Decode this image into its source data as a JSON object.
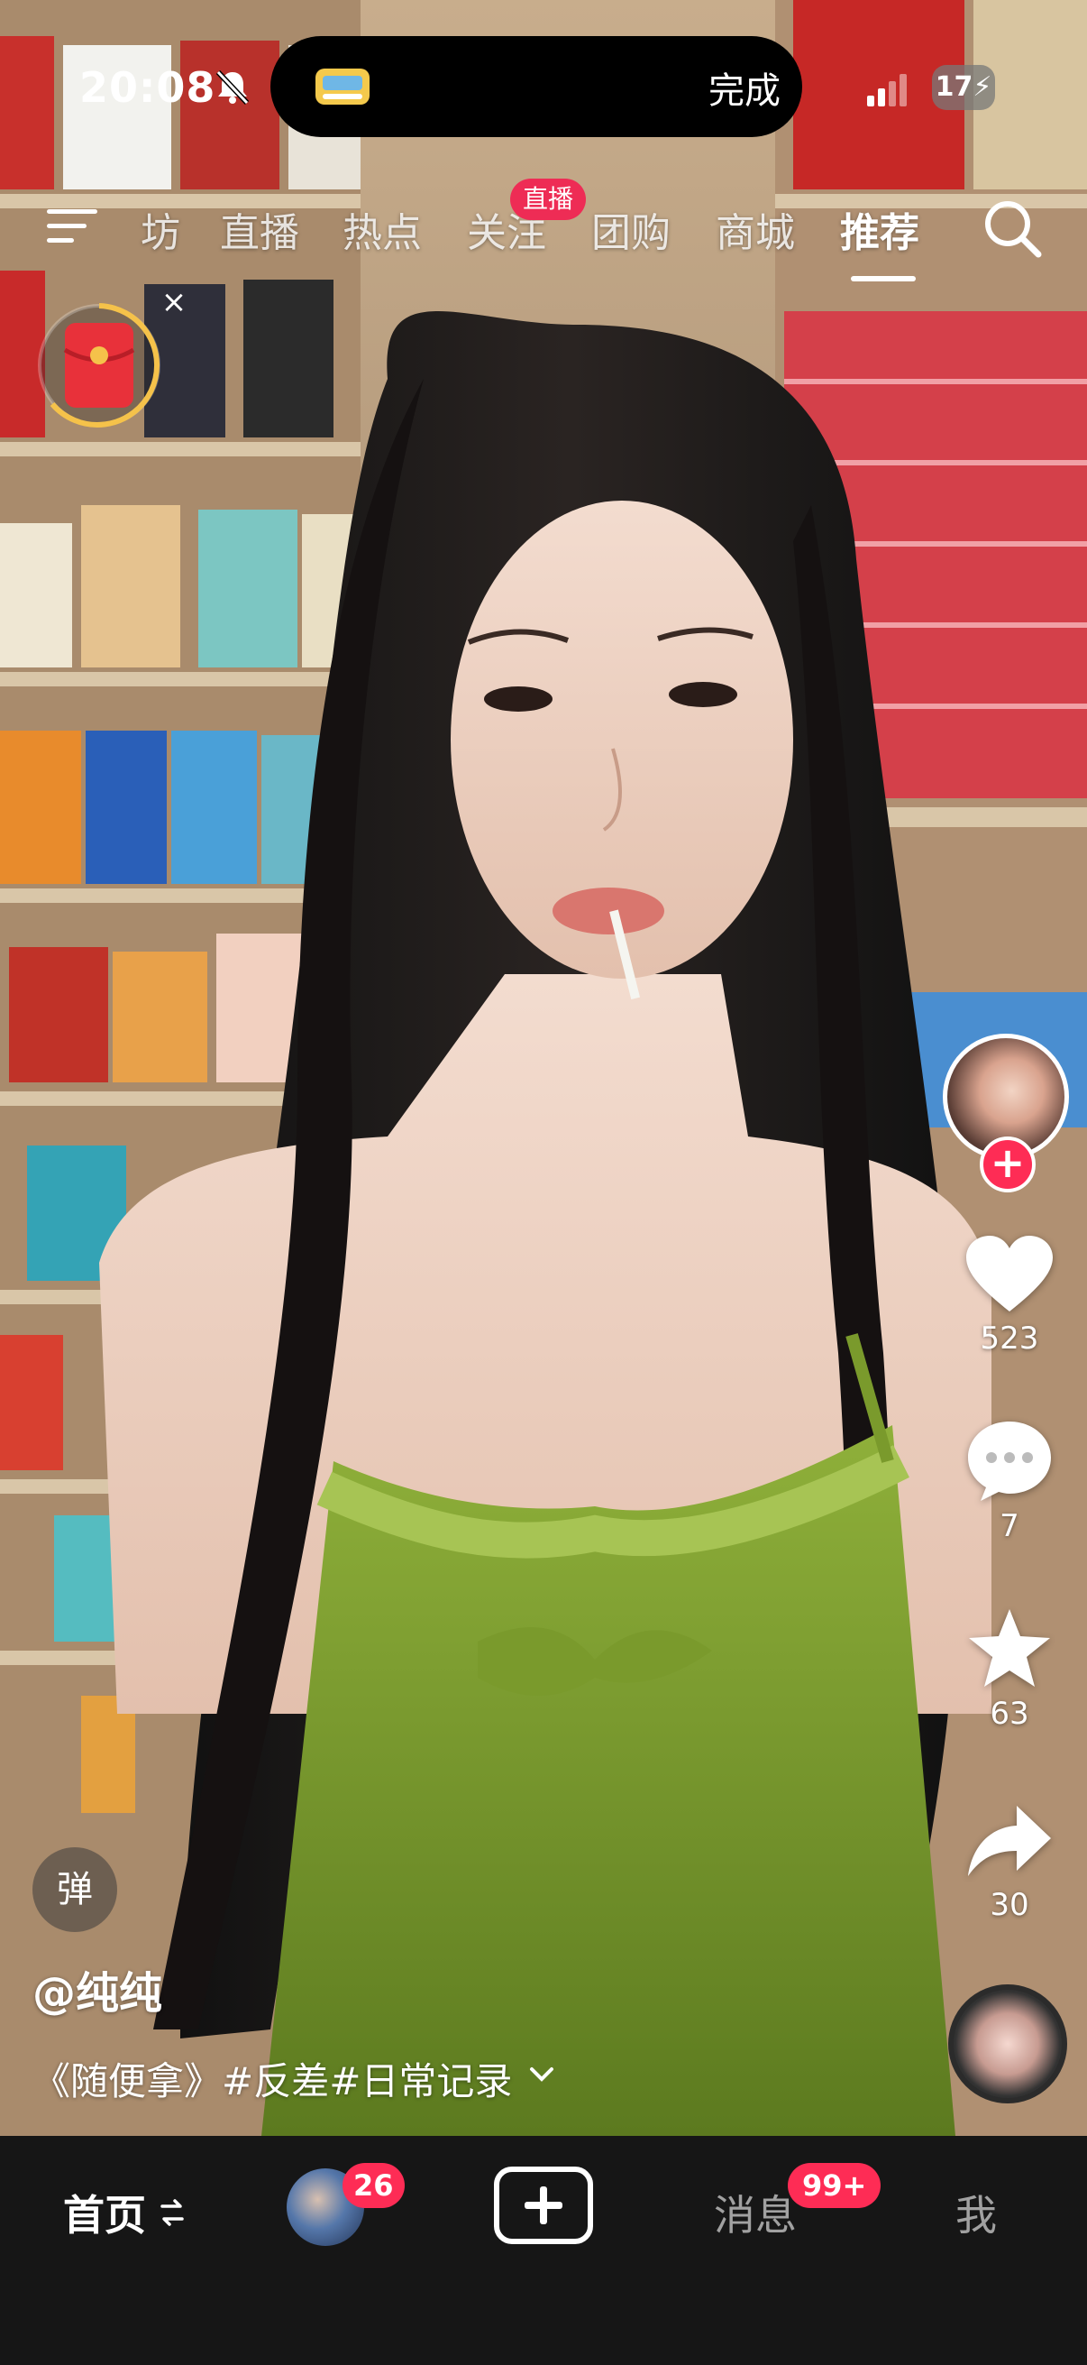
{
  "status_bar": {
    "time": "20:08",
    "island_action": "完成",
    "battery": "17"
  },
  "top_nav": {
    "tabs": [
      "坊",
      "直播",
      "热点",
      "关注",
      "团购",
      "商城",
      "推荐"
    ],
    "active_tab": "推荐",
    "live_badge": "直播"
  },
  "video": {
    "author": "@纯纯",
    "caption": "《随便拿》#反差#日常记录",
    "danmu_label": "弹"
  },
  "actions": {
    "likes": "523",
    "comments": "7",
    "favorites": "63",
    "shares": "30"
  },
  "bottom_nav": {
    "home": "首页",
    "friends_badge": "26",
    "messages": "消息",
    "messages_badge": "99+",
    "me": "我"
  },
  "colors": {
    "accent": "#fe2c55",
    "bar_bg": "#161616"
  }
}
